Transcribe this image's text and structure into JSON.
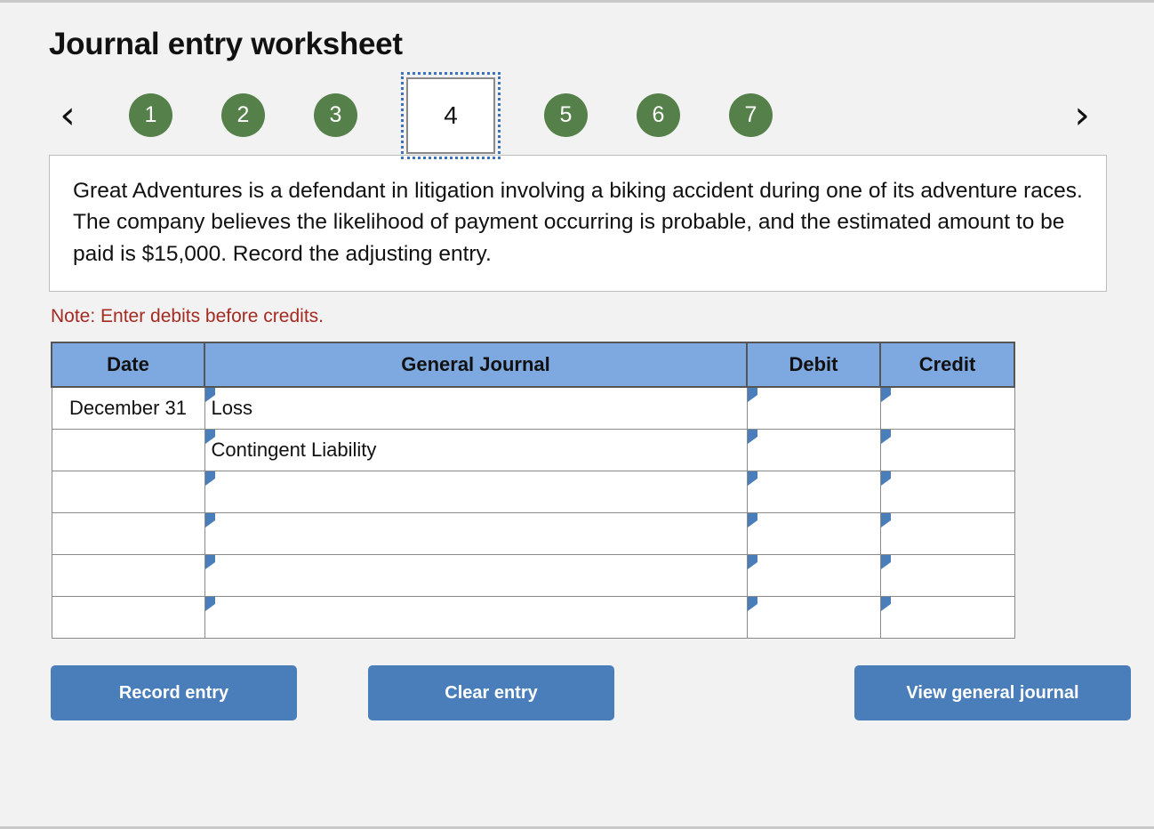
{
  "worksheet": {
    "title": "Journal entry worksheet",
    "note": "Note: Enter debits before credits."
  },
  "stepper": {
    "prev_icon": "‹",
    "next_icon": "›",
    "active_step": "4",
    "steps": [
      {
        "label": "1",
        "active": false
      },
      {
        "label": "2",
        "active": false
      },
      {
        "label": "3",
        "active": false
      },
      {
        "label": "4",
        "active": true
      },
      {
        "label": "5",
        "active": false
      },
      {
        "label": "6",
        "active": false
      },
      {
        "label": "7",
        "active": false
      }
    ]
  },
  "question": {
    "text": "Great Adventures is a defendant in litigation involving a biking accident during one of its adventure races. The company believes the likelihood of payment occurring is probable, and the estimated amount to be paid is $15,000. Record the adjusting entry."
  },
  "journal": {
    "headers": {
      "date": "Date",
      "general_journal": "General Journal",
      "debit": "Debit",
      "credit": "Credit"
    },
    "rows": [
      {
        "date": "December 31",
        "account": "Loss",
        "debit": "",
        "credit": ""
      },
      {
        "date": "",
        "account": "Contingent Liability",
        "debit": "",
        "credit": ""
      },
      {
        "date": "",
        "account": "",
        "debit": "",
        "credit": ""
      },
      {
        "date": "",
        "account": "",
        "debit": "",
        "credit": ""
      },
      {
        "date": "",
        "account": "",
        "debit": "",
        "credit": ""
      },
      {
        "date": "",
        "account": "",
        "debit": "",
        "credit": ""
      }
    ]
  },
  "buttons": {
    "record": "Record entry",
    "clear": "Clear entry",
    "view": "View general journal"
  },
  "colors": {
    "step_green": "#55804a",
    "header_blue": "#7ea8e0",
    "button_blue": "#4a7ebb",
    "note_red": "#a32b22",
    "cell_accent": "#4a7ebb",
    "page_background": "#f2f2f2"
  }
}
